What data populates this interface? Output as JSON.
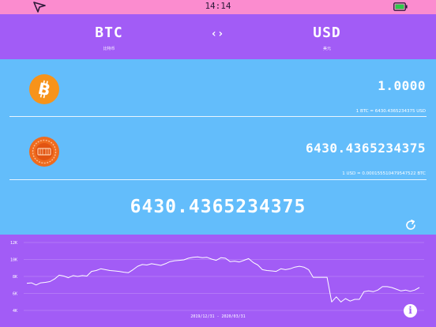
{
  "status_bar": {
    "time": "14:14"
  },
  "header": {
    "from": {
      "code": "BTC",
      "name": "比特币"
    },
    "swap_label": "‹›",
    "to": {
      "code": "USD",
      "name": "美元"
    }
  },
  "converter": {
    "from_amount": "1.0000",
    "from_rate": "1 BTC = 6430.4365234375 USD",
    "to_amount": "6430.4365234375",
    "to_rate": "1 USD = 0.000155510479547522 BTC",
    "result": "6430.4365234375"
  },
  "chart_data": {
    "type": "line",
    "title": "",
    "xlabel": "",
    "ylabel": "",
    "x_range_label": "2019/12/31 - 2020/03/31",
    "y_ticks": [
      4000,
      6000,
      8000,
      10000,
      12000
    ],
    "y_tick_labels": [
      "4K",
      "6K",
      "8K",
      "10K",
      "12K"
    ],
    "ylim": [
      4000,
      12000
    ],
    "grid": true,
    "series": [
      {
        "values": [
          7200,
          7250,
          7000,
          7250,
          7300,
          7400,
          7700,
          8150,
          8050,
          7850,
          8100,
          8000,
          8100,
          8050,
          8600,
          8700,
          8900,
          8800,
          8700,
          8650,
          8600,
          8500,
          8450,
          8800,
          9200,
          9400,
          9350,
          9500,
          9400,
          9300,
          9500,
          9750,
          9850,
          9900,
          9950,
          10150,
          10250,
          10300,
          10200,
          10250,
          10050,
          9900,
          10200,
          10150,
          9750,
          9800,
          9700,
          9900,
          10100,
          9650,
          9350,
          8800,
          8700,
          8650,
          8600,
          8900,
          8800,
          8900,
          9100,
          9200,
          9100,
          8800,
          7900,
          7900,
          7900,
          7900,
          5000,
          5600,
          5000,
          5400,
          5100,
          5300,
          5300,
          6200,
          6300,
          6200,
          6400,
          6800,
          6800,
          6700,
          6500,
          6300,
          6400,
          6250,
          6400,
          6700
        ]
      }
    ],
    "colors": {
      "line": "#ffffff",
      "grid": "rgba(255,255,255,0.35)"
    }
  },
  "icons": [
    "location-arrow-icon",
    "battery-icon",
    "bitcoin-icon",
    "coin-icon",
    "refresh-icon",
    "info-icon"
  ]
}
